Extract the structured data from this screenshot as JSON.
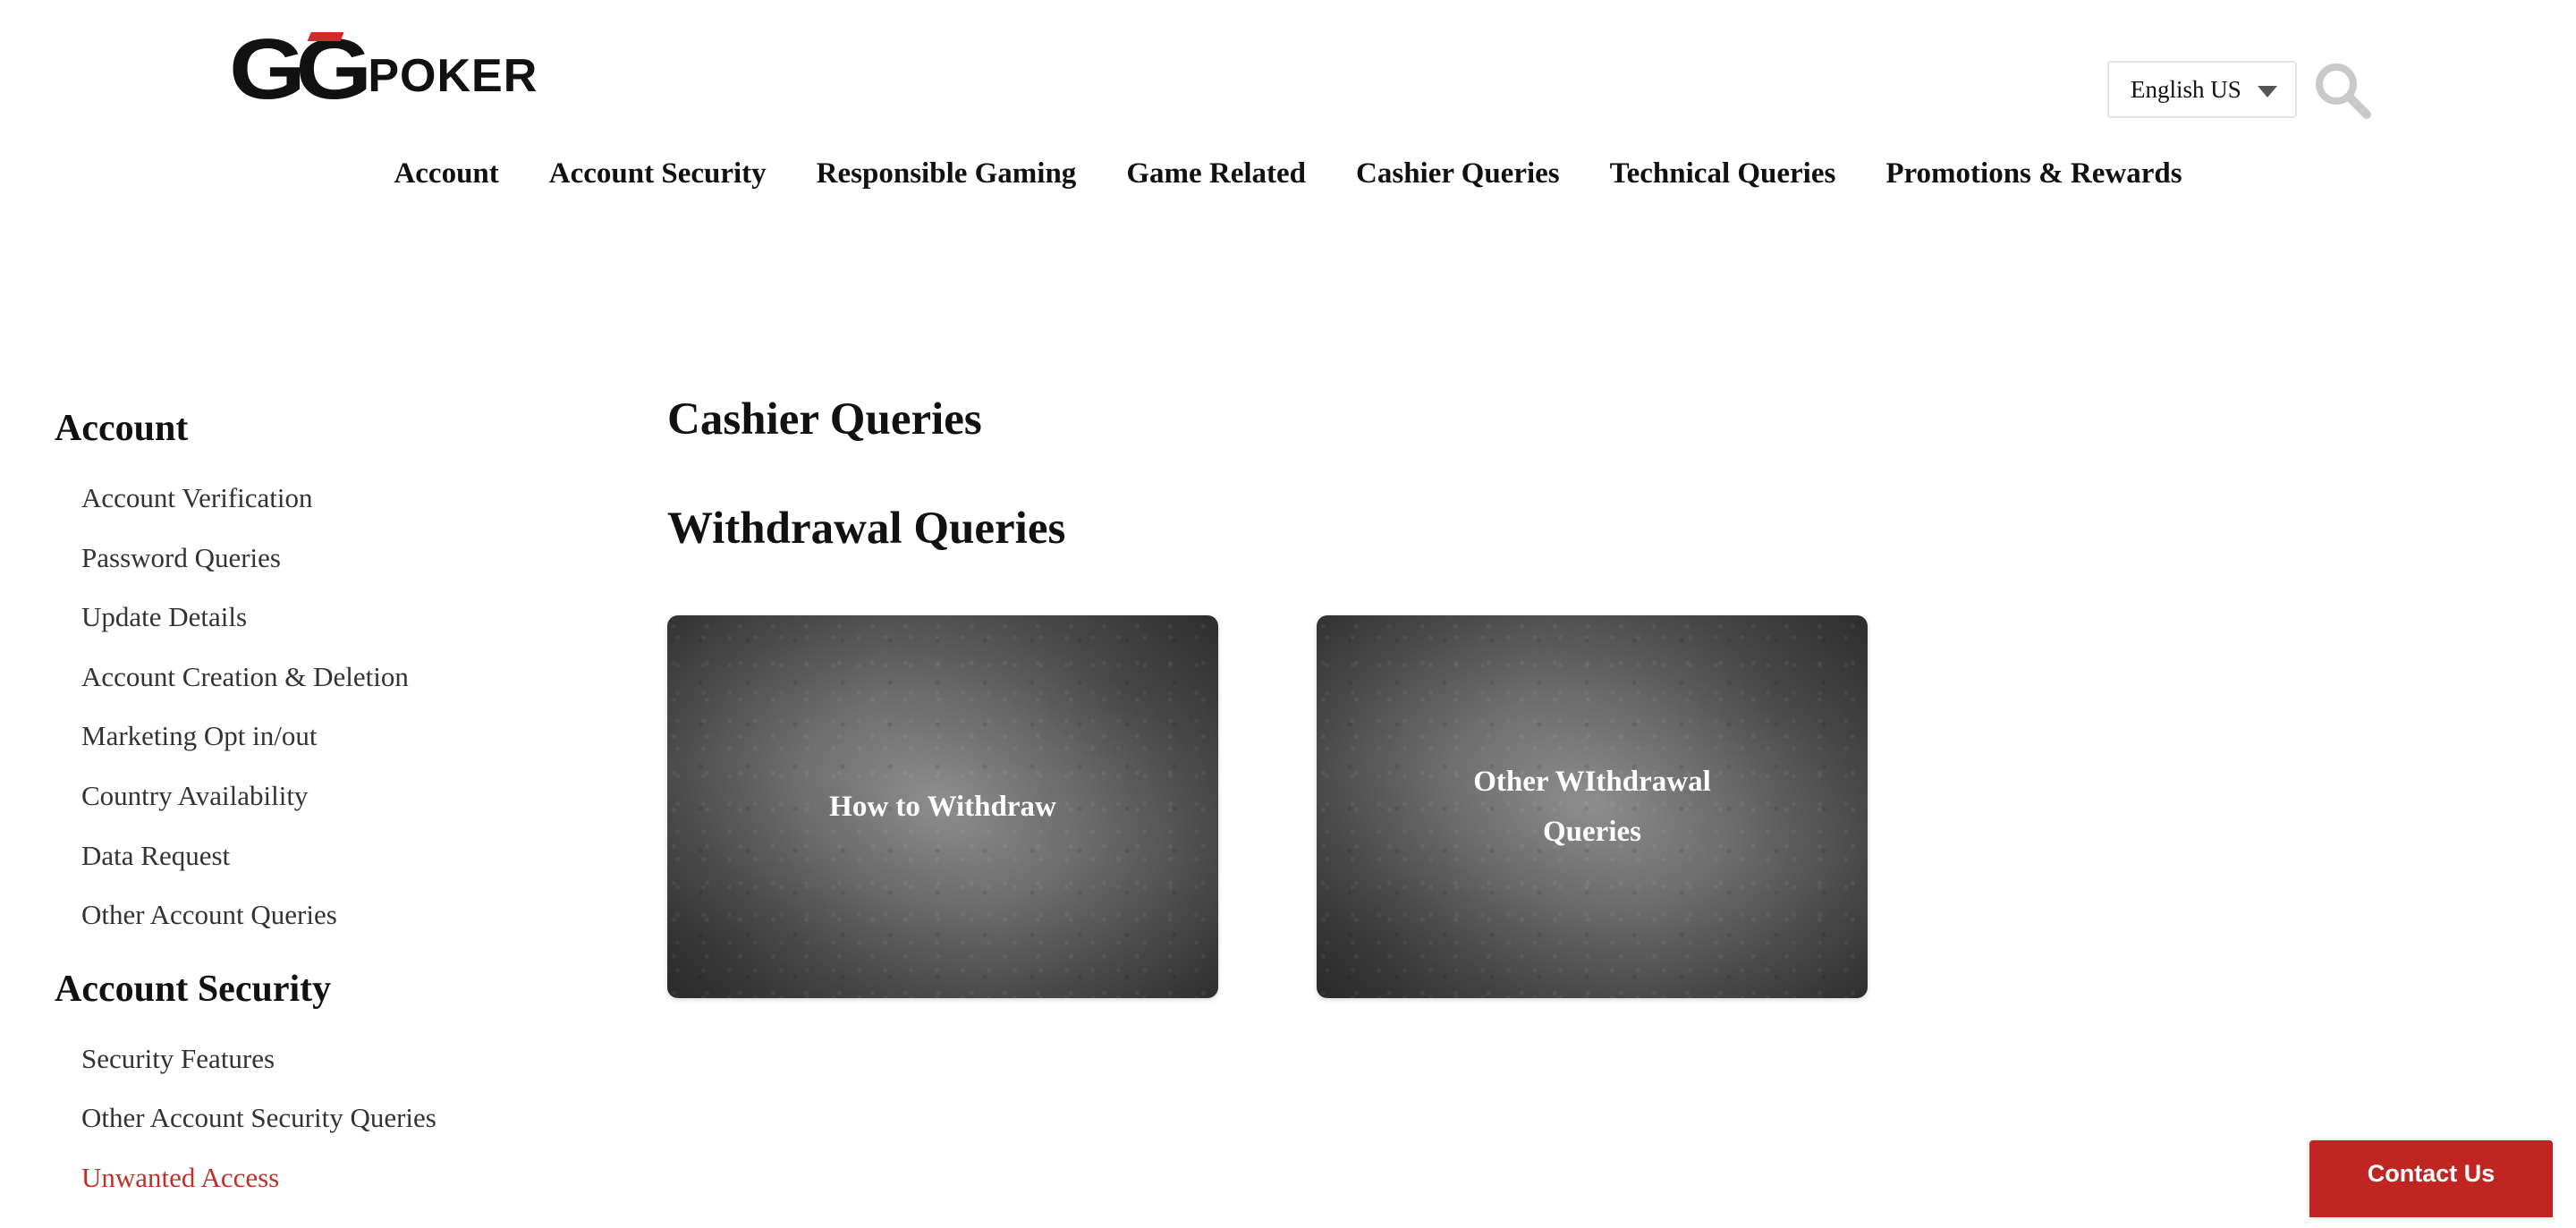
{
  "header": {
    "logo": {
      "gg_text": "GG",
      "poker_text": "POKER",
      "accent_color": "#d02a2a"
    },
    "language_select": {
      "value": "English US"
    },
    "search_icon": "search-icon"
  },
  "nav": {
    "items": [
      {
        "label": "Account"
      },
      {
        "label": "Account Security"
      },
      {
        "label": "Responsible Gaming"
      },
      {
        "label": "Game Related"
      },
      {
        "label": "Cashier Queries"
      },
      {
        "label": "Technical Queries"
      },
      {
        "label": "Promotions & Rewards"
      }
    ]
  },
  "sidebar": {
    "sections": [
      {
        "title": "Account",
        "items": [
          {
            "label": "Account Verification"
          },
          {
            "label": "Password Queries"
          },
          {
            "label": "Update Details"
          },
          {
            "label": "Account Creation & Deletion"
          },
          {
            "label": "Marketing Opt in/out"
          },
          {
            "label": "Country Availability"
          },
          {
            "label": "Data Request"
          },
          {
            "label": "Other Account Queries"
          }
        ]
      },
      {
        "title": "Account Security",
        "items": [
          {
            "label": "Security Features"
          },
          {
            "label": "Other Account Security Queries"
          },
          {
            "label": "Unwanted Access"
          }
        ]
      }
    ],
    "active_color": "#c0302a"
  },
  "main": {
    "page_title": "Cashier Queries",
    "section_title": "Withdrawal Queries",
    "cards": [
      {
        "label": "How to Withdraw"
      },
      {
        "label": "Other WIthdrawal Queries"
      }
    ]
  },
  "contact": {
    "label": "Contact Us",
    "color": "#bf2622"
  }
}
